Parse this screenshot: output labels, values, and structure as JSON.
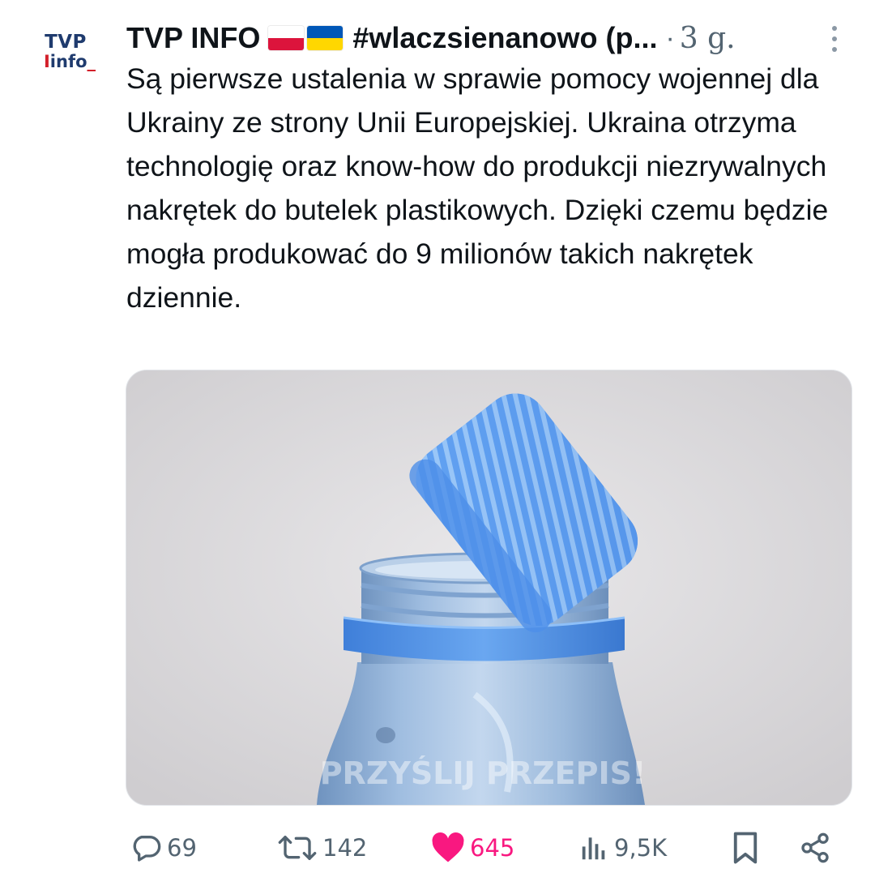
{
  "author": {
    "avatar_line1": "TVP",
    "avatar_line2": "info",
    "name": "TVP INFO",
    "handle": "#wlaczsienanowo (p...",
    "separator": "·",
    "timestamp": "3 g."
  },
  "tweet": {
    "text": "Są pierwsze ustalenia w sprawie pomocy wojennej dla Ukrainy ze strony Unii Europejskiej. Ukraina otrzyma technologię oraz know-how do produkcji niezrywalnych nakrętek do butelek plastikowych. Dzięki czemu będzie mogła produkować do 9 milionów takich nakrętek dziennie."
  },
  "media": {
    "watermark": "PRZYŚLIJ PRZEPIS!"
  },
  "actions": {
    "replies": "69",
    "reposts": "142",
    "likes": "645",
    "views": "9,5K"
  },
  "colors": {
    "like": "#f91880",
    "muted": "#536471",
    "cap_blue": "#4a8ee6"
  },
  "icons": {
    "reply": "reply-icon",
    "repost": "repost-icon",
    "like": "heart-icon",
    "views": "views-icon",
    "bookmark": "bookmark-icon",
    "share": "share-icon",
    "more": "more-icon"
  }
}
